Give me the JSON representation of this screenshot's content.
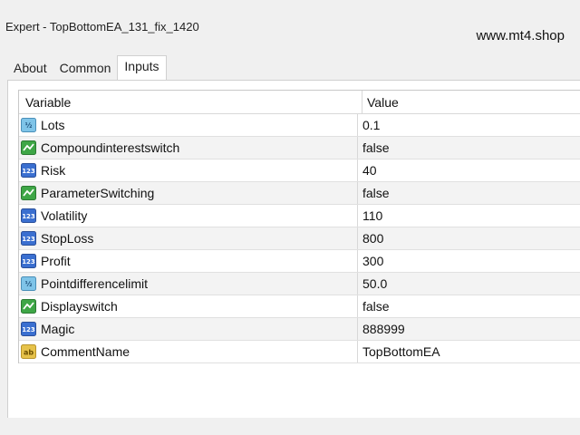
{
  "window": {
    "title": "Expert - TopBottomEA_131_fix_1420",
    "watermark": "www.mt4.shop"
  },
  "tabs": [
    {
      "label": "About",
      "active": false
    },
    {
      "label": "Common",
      "active": false
    },
    {
      "label": "Inputs",
      "active": true
    }
  ],
  "table": {
    "headers": {
      "variable": "Variable",
      "value": "Value"
    },
    "rows": [
      {
        "icon": "double-type-icon",
        "variable": "Lots",
        "value": "0.1"
      },
      {
        "icon": "bool-type-icon",
        "variable": "Compoundinterestswitch",
        "value": "false"
      },
      {
        "icon": "int-type-icon",
        "variable": "Risk",
        "value": "40"
      },
      {
        "icon": "bool-type-icon",
        "variable": "ParameterSwitching",
        "value": "false"
      },
      {
        "icon": "int-type-icon",
        "variable": "Volatility",
        "value": "110"
      },
      {
        "icon": "int-type-icon",
        "variable": "StopLoss",
        "value": "800"
      },
      {
        "icon": "int-type-icon",
        "variable": "Profit",
        "value": "300"
      },
      {
        "icon": "double-type-icon",
        "variable": "Pointdifferencelimit",
        "value": "50.0"
      },
      {
        "icon": "bool-type-icon",
        "variable": "Displayswitch",
        "value": "false"
      },
      {
        "icon": "int-type-icon",
        "variable": "Magic",
        "value": "888999"
      },
      {
        "icon": "string-type-icon",
        "variable": "CommentName",
        "value": "TopBottomEA"
      }
    ]
  },
  "colors": {
    "int_icon": "#3a6fd0",
    "double_icon": "#7fc4e8",
    "bool_icon": "#3ea646",
    "string_icon": "#e6c24a"
  }
}
